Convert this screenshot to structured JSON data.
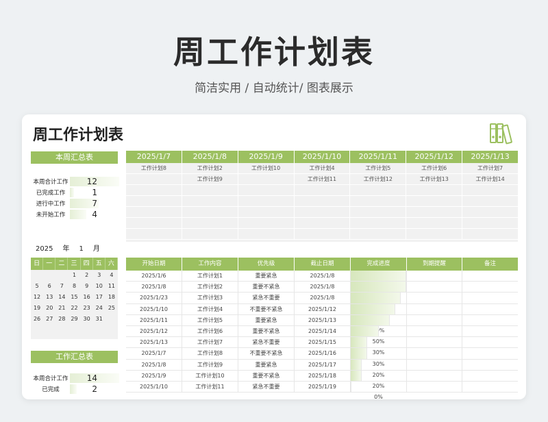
{
  "hero": {
    "title": "周工作计划表",
    "subtitle": "简洁实用 / 自动统计/ 图表展示"
  },
  "card": {
    "title": "周工作计划表",
    "icon": "binder-icon"
  },
  "weekly_summary": {
    "header": "本周汇总表",
    "rows": [
      {
        "label": "本周合计工作",
        "value": "12",
        "fraction": 1.0
      },
      {
        "label": "已完成工作",
        "value": "1",
        "fraction": 0.08
      },
      {
        "label": "进行中工作",
        "value": "7",
        "fraction": 0.58
      },
      {
        "label": "未开始工作",
        "value": "4",
        "fraction": 0.33
      }
    ]
  },
  "calendar": {
    "year": "2025",
    "year_unit": "年",
    "month": "1",
    "month_unit": "月",
    "weekdays": [
      "日",
      "一",
      "二",
      "三",
      "四",
      "五",
      "六"
    ],
    "weeks": [
      [
        "",
        "",
        "",
        "1",
        "2",
        "3",
        "4"
      ],
      [
        "5",
        "6",
        "7",
        "8",
        "9",
        "10",
        "11"
      ],
      [
        "12",
        "13",
        "14",
        "15",
        "16",
        "17",
        "18"
      ],
      [
        "19",
        "20",
        "21",
        "22",
        "23",
        "24",
        "25"
      ],
      [
        "26",
        "27",
        "28",
        "29",
        "30",
        "31",
        ""
      ]
    ]
  },
  "work_summary": {
    "header": "工作汇总表",
    "rows": [
      {
        "label": "本周合计工作",
        "value": "14",
        "fraction": 1.0
      },
      {
        "label": "已完成",
        "value": "2",
        "fraction": 0.14
      }
    ]
  },
  "week_plan": {
    "dates": [
      "2025/1/7",
      "2025/1/8",
      "2025/1/9",
      "2025/1/10",
      "2025/1/11",
      "2025/1/12",
      "2025/1/13"
    ],
    "tasks": [
      [
        "工作计划8"
      ],
      [
        "工作计划2",
        "工作计划9"
      ],
      [
        "工作计划10"
      ],
      [
        "工作计划4",
        "工作计划11"
      ],
      [
        "工作计划5",
        "工作计划12"
      ],
      [
        "工作计划6",
        "工作计划13"
      ],
      [
        "工作计划7",
        "工作计划14"
      ]
    ]
  },
  "task_table": {
    "headers": [
      "开始日期",
      "工作内容",
      "优先级",
      "截止日期",
      "完成进度",
      "到期提醒",
      "备注"
    ],
    "rows": [
      {
        "start": "2025/1/6",
        "content": "工作计划1",
        "priority": "重要紧急",
        "due": "2025/1/8",
        "progress": "100%",
        "p": 1.0,
        "remind": "",
        "note": ""
      },
      {
        "start": "2025/1/8",
        "content": "工作计划2",
        "priority": "重要不紧急",
        "due": "2025/1/8",
        "progress": "100%",
        "p": 1.0,
        "remind": "",
        "note": ""
      },
      {
        "start": "2025/1/23",
        "content": "工作计划3",
        "priority": "紧急不重要",
        "due": "2025/1/8",
        "progress": "90%",
        "p": 0.9,
        "remind": "",
        "note": ""
      },
      {
        "start": "2025/1/10",
        "content": "工作计划4",
        "priority": "不重要不紧急",
        "due": "2025/1/12",
        "progress": "80%",
        "p": 0.8,
        "remind": "",
        "note": ""
      },
      {
        "start": "2025/1/11",
        "content": "工作计划5",
        "priority": "重要紧急",
        "due": "2025/1/13",
        "progress": "70%",
        "p": 0.7,
        "remind": "",
        "note": ""
      },
      {
        "start": "2025/1/12",
        "content": "工作计划6",
        "priority": "重要不紧急",
        "due": "2025/1/14",
        "progress": "50%",
        "p": 0.5,
        "remind": "",
        "note": ""
      },
      {
        "start": "2025/1/13",
        "content": "工作计划7",
        "priority": "紧急不重要",
        "due": "2025/1/15",
        "progress": "30%",
        "p": 0.3,
        "remind": "",
        "note": ""
      },
      {
        "start": "2025/1/7",
        "content": "工作计划8",
        "priority": "不重要不紧急",
        "due": "2025/1/16",
        "progress": "30%",
        "p": 0.3,
        "remind": "",
        "note": ""
      },
      {
        "start": "2025/1/8",
        "content": "工作计划9",
        "priority": "重要紧急",
        "due": "2025/1/17",
        "progress": "20%",
        "p": 0.2,
        "remind": "",
        "note": ""
      },
      {
        "start": "2025/1/9",
        "content": "工作计划10",
        "priority": "重要不紧急",
        "due": "2025/1/18",
        "progress": "20%",
        "p": 0.2,
        "remind": "",
        "note": ""
      },
      {
        "start": "2025/1/10",
        "content": "工作计划11",
        "priority": "紧急不重要",
        "due": "2025/1/19",
        "progress": "0%",
        "p": 0.0,
        "remind": "",
        "note": ""
      }
    ]
  },
  "colors": {
    "accent": "#9cc060",
    "background": "#eef1f3",
    "cell": "#f1f1f1"
  }
}
